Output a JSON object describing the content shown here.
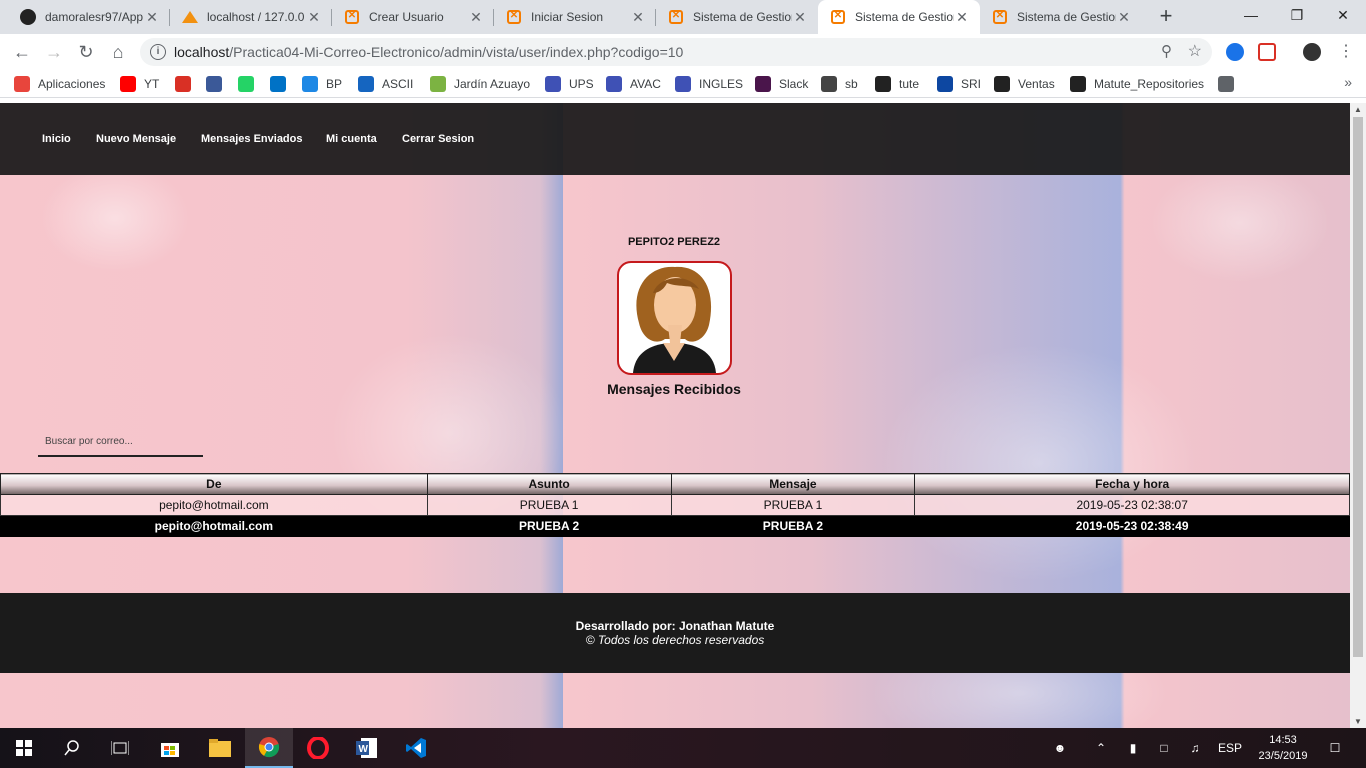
{
  "browser": {
    "tabs": [
      {
        "title": "damoralesr97/App",
        "icon": "github-icon",
        "active": false
      },
      {
        "title": "localhost / 127.0.0",
        "icon": "phpmyadmin-icon",
        "active": false
      },
      {
        "title": "Crear Usuario",
        "icon": "xampp-icon",
        "active": false
      },
      {
        "title": "Iniciar Sesion",
        "icon": "xampp-icon",
        "active": false
      },
      {
        "title": "Sistema de Gestion",
        "icon": "xampp-icon",
        "active": false
      },
      {
        "title": "Sistema de Gestion",
        "icon": "xampp-icon",
        "active": true
      },
      {
        "title": "Sistema de Gestion",
        "icon": "xampp-icon",
        "active": false
      }
    ],
    "close_glyph": "✕",
    "newtab_glyph": "+",
    "url_host": "localhost",
    "url_path": "/Practica04-Mi-Correo-Electronico/admin/vista/user/index.php?codigo=10",
    "bookmarks": [
      {
        "label": "Aplicaciones",
        "icon": "apps-grid-icon",
        "color": "#e8453c"
      },
      {
        "label": "YT",
        "icon": "youtube-icon",
        "color": "#ff0000"
      },
      {
        "label": "",
        "icon": "gmail-icon",
        "color": "#d93025"
      },
      {
        "label": "",
        "icon": "facebook-icon",
        "color": "#3b5998"
      },
      {
        "label": "",
        "icon": "whatsapp-icon",
        "color": "#25d366"
      },
      {
        "label": "",
        "icon": "outlook-icon",
        "color": "#0072c6"
      },
      {
        "label": "BP",
        "icon": "bp-icon",
        "color": "#1e88e5"
      },
      {
        "label": "ASCII",
        "icon": "ascii-icon",
        "color": "#1565c0"
      },
      {
        "label": "Jardín Azuayo",
        "icon": "jardin-azuayo-icon",
        "color": "#7cb342"
      },
      {
        "label": "UPS",
        "icon": "ups-icon",
        "color": "#3f51b5"
      },
      {
        "label": "AVAC",
        "icon": "avac-icon",
        "color": "#3f51b5"
      },
      {
        "label": "INGLES",
        "icon": "ingles-icon",
        "color": "#3f51b5"
      },
      {
        "label": "Slack",
        "icon": "slack-icon",
        "color": "#4a154b"
      },
      {
        "label": "sb",
        "icon": "sb-icon",
        "color": "#444444"
      },
      {
        "label": "tute",
        "icon": "github-icon",
        "color": "#222222"
      },
      {
        "label": "SRI",
        "icon": "sri-icon",
        "color": "#0d47a1"
      },
      {
        "label": "Ventas",
        "icon": "github-icon",
        "color": "#222222"
      },
      {
        "label": "Matute_Repositories",
        "icon": "github-icon",
        "color": "#222222"
      },
      {
        "label": "",
        "icon": "globe-icon",
        "color": "#5f6368"
      }
    ]
  },
  "site": {
    "nav": [
      "Inicio",
      "Nuevo Mensaje",
      "Mensajes Enviados",
      "Mi cuenta",
      "Cerrar Sesion"
    ],
    "user_name": "PEPITO2 PEREZ2",
    "section_title": "Mensajes Recibidos",
    "search_placeholder": "Buscar por correo...",
    "table": {
      "headers": [
        "De",
        "Asunto",
        "Mensaje",
        "Fecha y hora"
      ],
      "rows": [
        [
          "pepito@hotmail.com",
          "PRUEBA 1",
          "PRUEBA 1",
          "2019-05-23 02:38:07"
        ],
        [
          "pepito@hotmail.com",
          "PRUEBA 2",
          "PRUEBA 2",
          "2019-05-23 02:38:49"
        ]
      ]
    },
    "footer_dev": "Desarrollado por: Jonathan Matute",
    "footer_rights": "© Todos los derechos reservados"
  },
  "taskbar": {
    "language": "ESP",
    "time": "14:53",
    "date": "23/5/2019"
  }
}
